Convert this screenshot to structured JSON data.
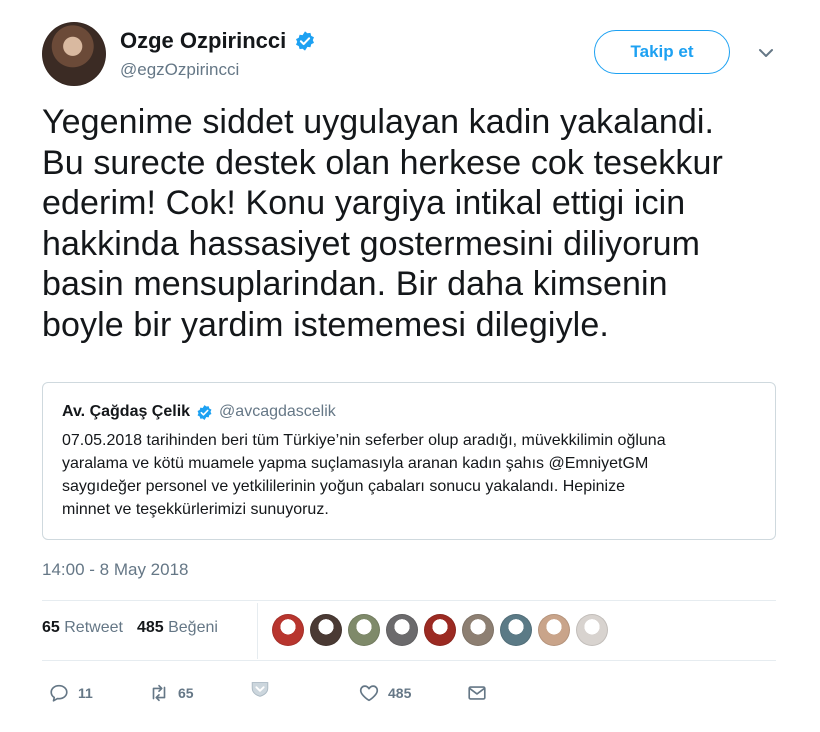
{
  "author": {
    "display_name": "Ozge Ozpirincci",
    "handle": "@egzOzpirincci",
    "verified": true
  },
  "follow_button_label": "Takip et",
  "tweet_lines": [
    "Yegenime siddet uygulayan kadin yakalandi.",
    "Bu surecte destek olan herkese cok tesekkur",
    "ederim! Cok! Konu yargiya intikal ettigi icin",
    "hakkinda hassasiyet gostermesini diliyorum",
    "basin mensuplarindan. Bir daha kimsenin",
    "boyle bir yardim istememesi dilegiyle."
  ],
  "quoted_tweet": {
    "display_name": "Av. Çağdaş Çelik",
    "handle": "@avcagdascelik",
    "verified": true,
    "lines": [
      "07.05.2018 tarihinden beri tüm Türkiye’nin seferber olup aradığı, müvekkilimin oğluna",
      "yaralama ve kötü muamele yapma suçlamasıyla aranan kadın şahıs @EmniyetGM",
      "saygıdeğer personel ve yetkililerinin yoğun çabaları sonucu yakalandı. Hepinize",
      "minnet ve teşekkürlerimizi sunuyoruz."
    ]
  },
  "timestamp": "14:00 - 8 May 2018",
  "stats": {
    "retweets_count": "65",
    "retweets_label": "Retweet",
    "likes_count": "485",
    "likes_label": "Beğeni"
  },
  "liker_avatar_colors": [
    "#b8352e",
    "#4a3a34",
    "#7f8a6a",
    "#6b6a6c",
    "#9b2a22",
    "#8d7f72",
    "#5b7a86",
    "#c9a48a",
    "#d8d3cf"
  ],
  "actions": {
    "reply_count": "11",
    "retweet_count": "65",
    "like_count": "485"
  },
  "colors": {
    "accent": "#1da1f2",
    "text": "#14171a",
    "muted": "#657786"
  }
}
